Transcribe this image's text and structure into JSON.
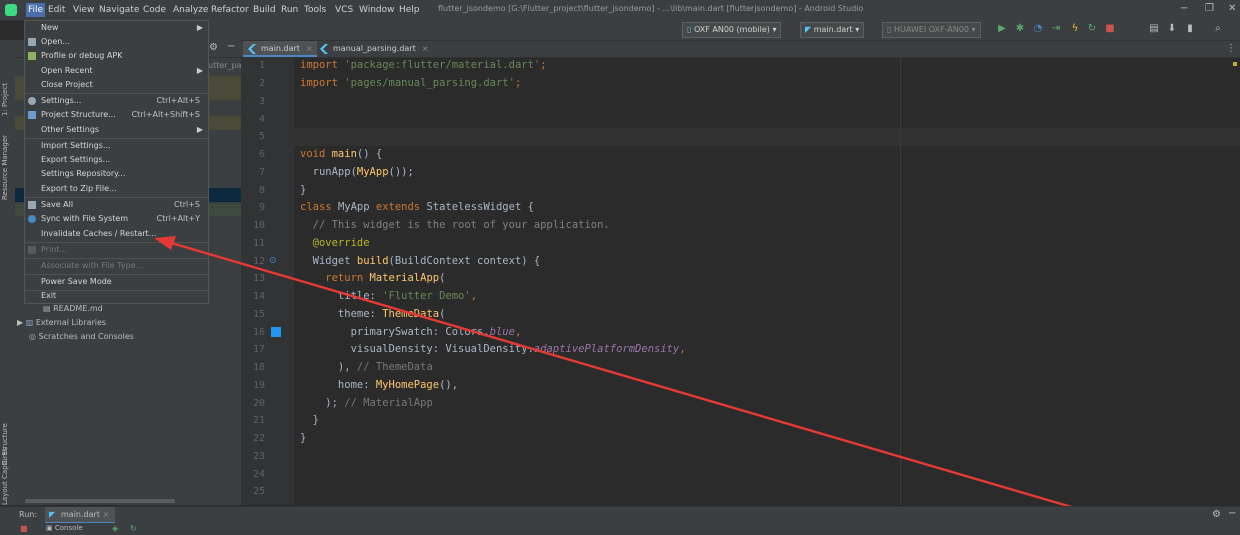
{
  "menubar": [
    "File",
    "Edit",
    "View",
    "Navigate",
    "Code",
    "Analyze",
    "Refactor",
    "Build",
    "Run",
    "Tools",
    "VCS",
    "Window",
    "Help"
  ],
  "window_title": "flutter_jsondemo [G:\\Flutter_project\\flutter_jsondemo] - ...\\lib\\main.dart [flutterjsondemo] - Android Studio",
  "toolbar": {
    "device": "OXF AN00 (mobile)",
    "run_config": "main.dart",
    "target": "HUAWEI OXF-AN00"
  },
  "tabs": [
    {
      "label": "main.dart",
      "active": true
    },
    {
      "label": "manual_parsing.dart",
      "active": false
    }
  ],
  "left_stripe": [
    "1: Project",
    "Resource Manager",
    "Z: Structure",
    "Layout Captures"
  ],
  "project_tree": {
    "partial": "utter_pa",
    "readme": "README.md",
    "external": "External Libraries",
    "scratches": "Scratches and Consoles"
  },
  "file_menu": [
    {
      "label": "New",
      "shortcut": "",
      "submenu": true,
      "disabled": false
    },
    {
      "label": "Open...",
      "shortcut": "",
      "submenu": false,
      "disabled": false
    },
    {
      "label": "Profile or debug APK",
      "shortcut": "",
      "submenu": false,
      "disabled": false
    },
    {
      "label": "Open Recent",
      "shortcut": "",
      "submenu": true,
      "disabled": false
    },
    {
      "label": "Close Project",
      "shortcut": "",
      "submenu": false,
      "disabled": false
    },
    {
      "label": "Settings...",
      "shortcut": "Ctrl+Alt+S",
      "submenu": false,
      "disabled": false
    },
    {
      "label": "Project Structure...",
      "shortcut": "Ctrl+Alt+Shift+S",
      "submenu": false,
      "disabled": false
    },
    {
      "label": "Other Settings",
      "shortcut": "",
      "submenu": true,
      "disabled": false
    },
    {
      "label": "Import Settings...",
      "shortcut": "",
      "submenu": false,
      "disabled": false
    },
    {
      "label": "Export Settings...",
      "shortcut": "",
      "submenu": false,
      "disabled": false
    },
    {
      "label": "Settings Repository...",
      "shortcut": "",
      "submenu": false,
      "disabled": false
    },
    {
      "label": "Export to Zip File...",
      "shortcut": "",
      "submenu": false,
      "disabled": false
    },
    {
      "label": "Save All",
      "shortcut": "Ctrl+S",
      "submenu": false,
      "disabled": false
    },
    {
      "label": "Sync with File System",
      "shortcut": "Ctrl+Alt+Y",
      "submenu": false,
      "disabled": false
    },
    {
      "label": "Invalidate Caches / Restart...",
      "shortcut": "",
      "submenu": false,
      "disabled": false
    },
    {
      "label": "Print...",
      "shortcut": "",
      "submenu": false,
      "disabled": true
    },
    {
      "label": "Associate with File Type...",
      "shortcut": "",
      "submenu": false,
      "disabled": true
    },
    {
      "label": "Power Save Mode",
      "shortcut": "",
      "submenu": false,
      "disabled": false
    },
    {
      "label": "Exit",
      "shortcut": "",
      "submenu": false,
      "disabled": false
    }
  ],
  "line_numbers": [
    "1",
    "2",
    "3",
    "4",
    "5",
    "6",
    "7",
    "8",
    "9",
    "10",
    "11",
    "12",
    "13",
    "14",
    "15",
    "16",
    "17",
    "18",
    "19",
    "20",
    "21",
    "22",
    "23",
    "24",
    "25"
  ],
  "code": {
    "l1a": "import ",
    "l1b": "'package:flutter/material.dart'",
    "l1c": ";",
    "l2a": "import ",
    "l2b": "'pages/manual_parsing.dart'",
    "l2c": ";",
    "l6a": "void ",
    "l6b": "main",
    "l6c": "() {",
    "l7a": "  runApp(",
    "l7b": "MyApp",
    "l7c": "());",
    "l8": "}",
    "l9a": "class ",
    "l9b": "MyApp ",
    "l9c": "extends ",
    "l9d": "StatelessWidget {",
    "l10": "  // This widget is the root of your application.",
    "l11": "  @override",
    "l12a": "  Widget ",
    "l12b": "build",
    "l12c": "(BuildContext context) {",
    "l13a": "    return ",
    "l13b": "MaterialApp",
    "l13c": "(",
    "l14a": "      title: ",
    "l14b": "'Flutter Demo'",
    "l14c": ",",
    "l15a": "      theme: ",
    "l15b": "ThemeData",
    "l15c": "(",
    "l16a": "        primarySwatch: Colors.",
    "l16b": "blue",
    "l16c": ",",
    "l17a": "        visualDensity: VisualDensity.",
    "l17b": "adaptivePlatformDensity",
    "l17c": ",",
    "l18a": "      ), ",
    "l18b": "// ThemeData",
    "l19a": "      home: ",
    "l19b": "MyHomePage",
    "l19c": "(),",
    "l20a": "    ); ",
    "l20b": "// MaterialApp",
    "l21": "  }",
    "l22": "}"
  },
  "bottom": {
    "run_label": "Run:",
    "run_tab": "main.dart",
    "console": "Console"
  },
  "colors": {
    "accent": "#4b6eaf",
    "arrow": "#e53935",
    "bg": "#2b2b2b"
  },
  "icons": [
    "flutter-icon",
    "folder-icon",
    "gear-icon",
    "run-icon",
    "debug-icon",
    "stop-icon",
    "close-icon"
  ]
}
